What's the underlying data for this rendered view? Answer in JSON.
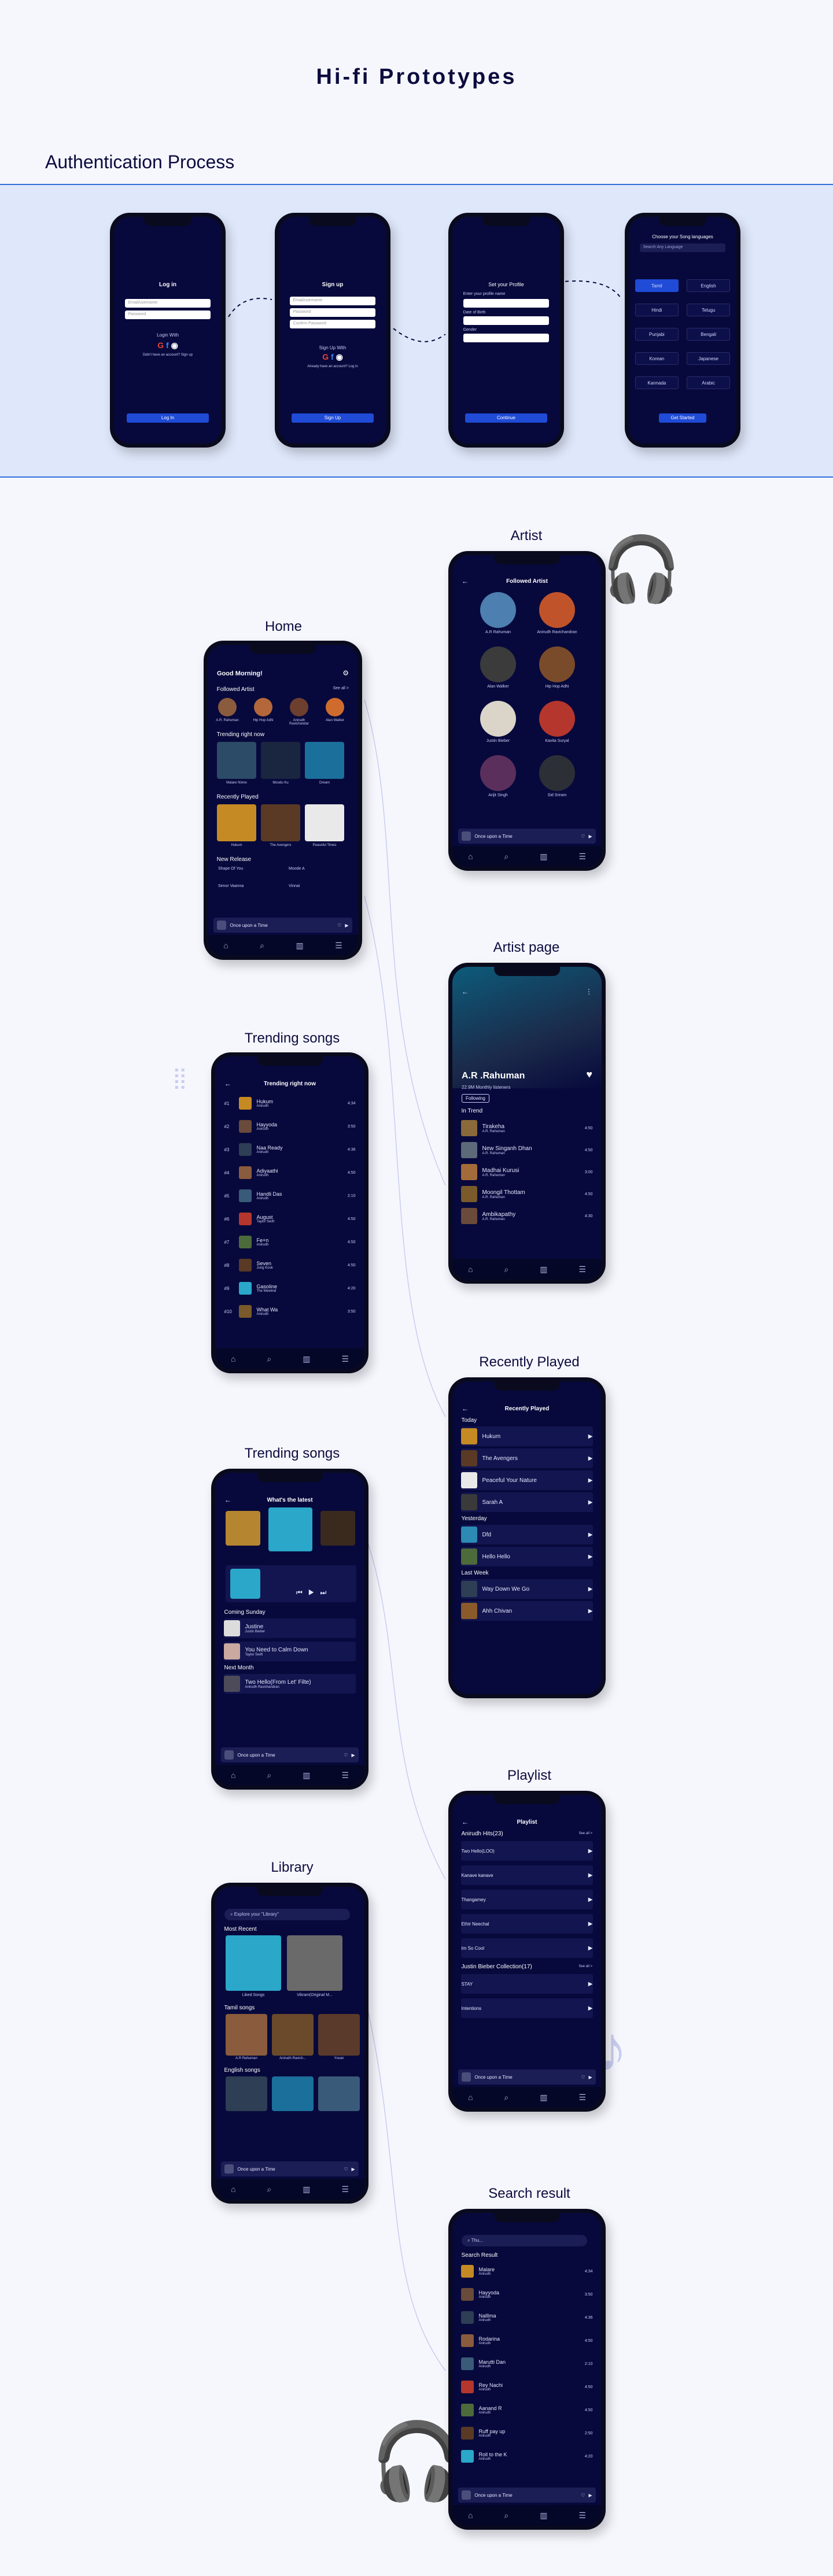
{
  "page": {
    "title": "Hi-fi Prototypes",
    "auth_section": "Authentication Process"
  },
  "labels": {
    "home": "Home",
    "artist": "Artist",
    "artist_page": "Artist page",
    "trending1": "Trending songs",
    "recently_played": "Recently Played",
    "trending2": "Trending songs",
    "playlist": "Playlist",
    "library": "Library",
    "search_result": "Search result"
  },
  "auth": {
    "login": {
      "title": "Log in",
      "email": "Email/username",
      "password": "Password",
      "or": "Login With",
      "signup_hint": "Didn't have an account? Sign up",
      "button": "Log In"
    },
    "signup": {
      "title": "Sign up",
      "email": "Email/username",
      "password": "Password",
      "confirm": "Confirm Password",
      "or": "Sign Up With",
      "hint": "Already have an account? Log in",
      "button": "Sign Up"
    },
    "profile": {
      "title": "Set your Profile",
      "name_label": "Enter your profile name",
      "dob": "Date of Birth",
      "gender": "Gender",
      "button": "Continue"
    },
    "language": {
      "title": "Choose your Song languages",
      "search": "Search Any Language",
      "languages": [
        "Tamil",
        "English",
        "Hindi",
        "Telugu",
        "Punjabi",
        "Bengali",
        "Korean",
        "Japanese",
        "Kannada",
        "Arabic"
      ],
      "button": "Get Started"
    }
  },
  "home": {
    "greeting": "Good Morning!",
    "followed": "Followed Artist",
    "see_all": "See all >",
    "artists": [
      "A.R. Rahuman",
      "Hip Hop Adhi",
      "Anirudh Ravichandar",
      "Alan Walker"
    ],
    "trending": "Trending right now",
    "trending_items": [
      "Malare Ninne",
      "Moodu Ku",
      "Dream"
    ],
    "recent": "Recently Played",
    "recent_items": [
      "Hukum",
      "The Avengers",
      "Peaceful Times"
    ],
    "new_release": "New Release",
    "new_items": [
      "Shape Of You",
      "Moode A",
      "Senor Vaanna",
      "Vinnai"
    ],
    "mini_player": "Once upon a Time"
  },
  "artist": {
    "header": "Followed Artist",
    "list": [
      "A.R Rahuman",
      "Anirudh Ravichandran",
      "Alan Walker",
      "Hip Hop Adhi",
      "Justin Bieber",
      "Kavita Suryal",
      "Arijit Singh",
      "Sid Sriram"
    ],
    "mini_player": "Once upon a Time"
  },
  "artist_page": {
    "name": "A.R .Rahuman",
    "listeners": "22.9M Monthly listeners",
    "following": "Following",
    "in_trend": "In Trend",
    "songs": [
      {
        "title": "Tirakeha",
        "artist": "A.R. Rahuman",
        "time": "4:50"
      },
      {
        "title": "New Singanh Dhan",
        "artist": "A.R. Rahuman",
        "time": "4:50"
      },
      {
        "title": "Madhai Kurusi",
        "artist": "A.R. Rahuman",
        "time": "3:00"
      },
      {
        "title": "Moongil Thottam",
        "artist": "A.R. Rahuman",
        "time": "4:50"
      },
      {
        "title": "Ambikapathy",
        "artist": "A.R. Rahuman",
        "time": "4:30"
      }
    ]
  },
  "trending_list": {
    "header": "Trending right now",
    "songs": [
      {
        "rank": "#1",
        "title": "Hukum",
        "artist": "Anirudh",
        "time": "4:34"
      },
      {
        "rank": "#2",
        "title": "Hayyoda",
        "artist": "Anirudh",
        "time": "3:50"
      },
      {
        "rank": "#3",
        "title": "Naa Ready",
        "artist": "Anirudh",
        "time": "4:36"
      },
      {
        "rank": "#4",
        "title": "Adiyaathi",
        "artist": "Anirudh",
        "time": "4:50"
      },
      {
        "rank": "#5",
        "title": "Handli Das",
        "artist": "Anirudh",
        "time": "2:10"
      },
      {
        "rank": "#6",
        "title": "August",
        "artist": "Taylor Swift",
        "time": "4:50"
      },
      {
        "rank": "#7",
        "title": "Fe+n",
        "artist": "Anirudh",
        "time": "4:50"
      },
      {
        "rank": "#8",
        "title": "Seven",
        "artist": "Jung Kook",
        "time": "4:50"
      },
      {
        "rank": "#9",
        "title": "Gasoline",
        "artist": "The Weeknd",
        "time": "4:20"
      },
      {
        "rank": "#10",
        "title": "What Wa",
        "artist": "Anirudh",
        "time": "3:50"
      }
    ]
  },
  "now_playing": {
    "header": "What's the latest",
    "coming": "Coming Sunday",
    "coming_items": [
      {
        "title": "Justine",
        "artist": "Justin Bieber"
      },
      {
        "title": "You Need to Calm Down",
        "artist": "Taylor Swift"
      }
    ],
    "next_month": "Next Month",
    "next_items": [
      {
        "title": "Two Hello(From Let' Filte)",
        "artist": "Anirudh Ravichandran"
      }
    ],
    "mini_player": "Once upon a Time"
  },
  "recent": {
    "header": "Recently Played",
    "today": "Today",
    "yesterday": "Yesterday",
    "last_week": "Last Week",
    "today_items": [
      "Hukum",
      "The Avengers",
      "Peaceful Your Nature",
      "Sarah A"
    ],
    "yesterday_items": [
      "Dfd",
      "Hello Hello"
    ],
    "week_items": [
      "Way Down We Go",
      "Ahh Chivan"
    ]
  },
  "playlist": {
    "header": "Playlist",
    "group1": "Anirudh Hits(23)",
    "group1_items": [
      "Two Hello(LOO)",
      "Kanave kanave",
      "Thangamey",
      "Ethir Neechal",
      "Im So Cool"
    ],
    "group2": "Justin Bieber Collection(17)",
    "group2_items": [
      "STAY",
      "Intentions"
    ],
    "see_all": "See all >",
    "mini_player": "Once upon a Time"
  },
  "library": {
    "search": "Explore your \"Library\"",
    "most_recent": "Most Recent",
    "recent_items": [
      "Liked Songs",
      "Vikram(Original M..."
    ],
    "tamil": "Tamil songs",
    "tamil_items": [
      "A.R Rahuman",
      "Anirudh Ravich...",
      "Yuvan"
    ],
    "english": "English songs",
    "mini_player": "Once upon a Time"
  },
  "search": {
    "query": "Thu...",
    "header": "Search Result",
    "items": [
      {
        "title": "Malare",
        "artist": "Anirudh",
        "time": "4:34"
      },
      {
        "title": "Hayyoda",
        "artist": "Anirudh",
        "time": "3:50"
      },
      {
        "title": "Nalllma",
        "artist": "Anirudh",
        "time": "4:36"
      },
      {
        "title": "Rodarina",
        "artist": "Anirudh",
        "time": "4:50"
      },
      {
        "title": "Marutti Dan",
        "artist": "Anirudh",
        "time": "2:10"
      },
      {
        "title": "Rey Nachi",
        "artist": "Anirudh",
        "time": "4:50"
      },
      {
        "title": "Aanand R",
        "artist": "Anirudh",
        "time": "4:50"
      },
      {
        "title": "Ruff pay up",
        "artist": "Anirudh",
        "time": "2:50"
      },
      {
        "title": "Roll to the K",
        "artist": "Anirudh",
        "time": "4:20"
      }
    ],
    "mini_player": "Once upon a Time"
  },
  "icons": {
    "home": "home-icon",
    "search": "search-icon",
    "library": "library-icon",
    "profile": "profile-icon"
  }
}
